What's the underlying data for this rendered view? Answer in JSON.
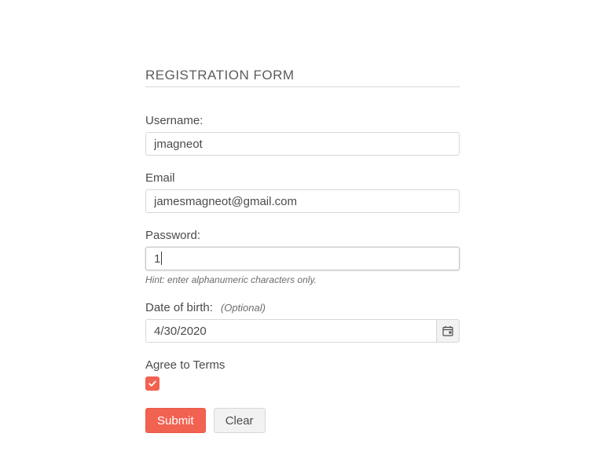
{
  "form": {
    "title": "REGISTRATION FORM",
    "username": {
      "label": "Username:",
      "value": "jmagneot"
    },
    "email": {
      "label": "Email",
      "value": "jamesmagneot@gmail.com"
    },
    "password": {
      "label": "Password:",
      "value": "1",
      "hint": "Hint: enter alphanumeric characters only."
    },
    "dob": {
      "label": "Date of birth:",
      "optional_text": "(Optional)",
      "value": "4/30/2020"
    },
    "terms": {
      "label": "Agree to Terms",
      "checked": true
    },
    "buttons": {
      "submit": "Submit",
      "clear": "Clear"
    }
  }
}
